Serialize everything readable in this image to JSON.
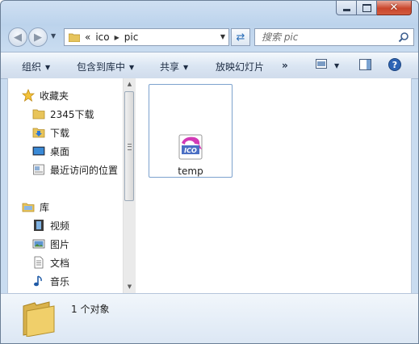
{
  "window": {
    "caption_buttons": {
      "minimize": "minimize",
      "maximize": "maximize",
      "close": "close"
    }
  },
  "address_bar": {
    "overflow": "«",
    "segments": [
      "ico",
      "pic"
    ]
  },
  "search": {
    "placeholder": "搜索 pic"
  },
  "toolbar": {
    "organize": "组织",
    "include_in_library": "包含到库中",
    "share": "共享",
    "slideshow": "放映幻灯片",
    "more": "»"
  },
  "nav_pane": {
    "favorites": {
      "label": "收藏夹",
      "items": [
        {
          "label": "2345下载",
          "icon": "folder-icon"
        },
        {
          "label": "下载",
          "icon": "downloads-icon"
        },
        {
          "label": "桌面",
          "icon": "desktop-icon"
        },
        {
          "label": "最近访问的位置",
          "icon": "recent-places-icon"
        }
      ]
    },
    "libraries": {
      "label": "库",
      "items": [
        {
          "label": "视频",
          "icon": "videos-icon"
        },
        {
          "label": "图片",
          "icon": "pictures-icon"
        },
        {
          "label": "文档",
          "icon": "documents-icon"
        },
        {
          "label": "音乐",
          "icon": "music-icon"
        }
      ]
    }
  },
  "files": [
    {
      "name": "temp",
      "icon": "ico-file-icon",
      "icon_text": "ICO"
    }
  ],
  "details": {
    "status": "1 个对象"
  },
  "colors": {
    "accent": "#2c6fb8",
    "selection_border": "#7da2ce",
    "close_button": "#c9462c"
  }
}
